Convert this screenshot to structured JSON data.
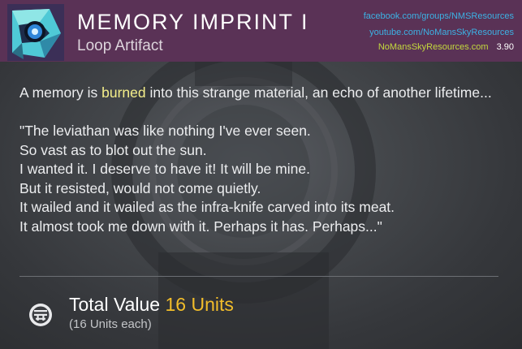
{
  "header": {
    "title": "MEMORY IMPRINT I",
    "subtitle": "Loop Artifact",
    "icon": "memory-imprint-artifact-icon",
    "background_color": "#5a3256"
  },
  "source": {
    "facebook": "facebook.com/groups/NMSResources",
    "youtube": "youtube.com/NoMansSkyResources",
    "site": "NoMansSkyResources.com",
    "version": "3.90"
  },
  "description": {
    "intro_before": "A memory is ",
    "intro_highlight": "burned",
    "intro_after": " into this strange material, an echo of another lifetime...",
    "quote_lines": [
      "\"The leviathan was like nothing I've ever seen.",
      "So vast as to blot out the sun.",
      "I wanted it. I deserve to have it! It will be mine.",
      "But it resisted, would not come quietly.",
      "It wailed and it wailed as the infra-knife carved into its meat.",
      "It almost took me down with it. Perhaps it has. Perhaps...\""
    ]
  },
  "value": {
    "label": "Total Value",
    "amount": "16 Units",
    "each": "(16 Units each)",
    "icon": "units-currency-icon"
  },
  "colors": {
    "highlight": "#f4ee8a",
    "value_accent": "#f2bd2a",
    "link_blue": "#3cb2e4",
    "link_green": "#c3d93d"
  }
}
